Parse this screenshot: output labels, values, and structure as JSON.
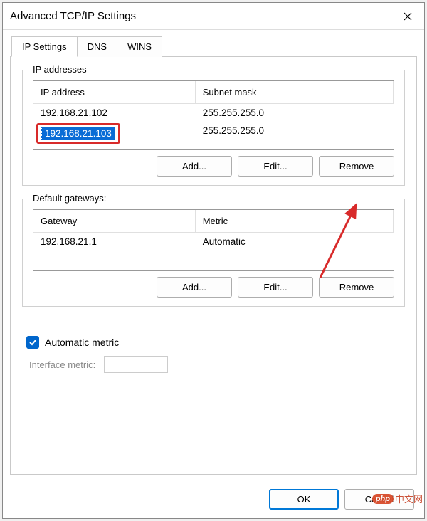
{
  "window": {
    "title": "Advanced TCP/IP Settings"
  },
  "tabs": {
    "ip_settings": "IP Settings",
    "dns": "DNS",
    "wins": "WINS"
  },
  "ip_addresses": {
    "group_label": "IP addresses",
    "columns": {
      "ip": "IP address",
      "mask": "Subnet mask"
    },
    "rows": [
      {
        "ip": "192.168.21.102",
        "mask": "255.255.255.0",
        "selected": false
      },
      {
        "ip": "192.168.21.103",
        "mask": "255.255.255.0",
        "selected": true
      }
    ],
    "buttons": {
      "add": "Add...",
      "edit": "Edit...",
      "remove": "Remove"
    }
  },
  "gateways": {
    "group_label": "Default gateways:",
    "columns": {
      "gateway": "Gateway",
      "metric": "Metric"
    },
    "rows": [
      {
        "gateway": "192.168.21.1",
        "metric": "Automatic"
      }
    ],
    "buttons": {
      "add": "Add...",
      "edit": "Edit...",
      "remove": "Remove"
    }
  },
  "metric": {
    "auto_label": "Automatic metric",
    "interface_label": "Interface metric:",
    "value": ""
  },
  "footer": {
    "ok": "OK",
    "cancel": "Cancel"
  },
  "watermark": {
    "badge": "php",
    "text": "中文网"
  }
}
